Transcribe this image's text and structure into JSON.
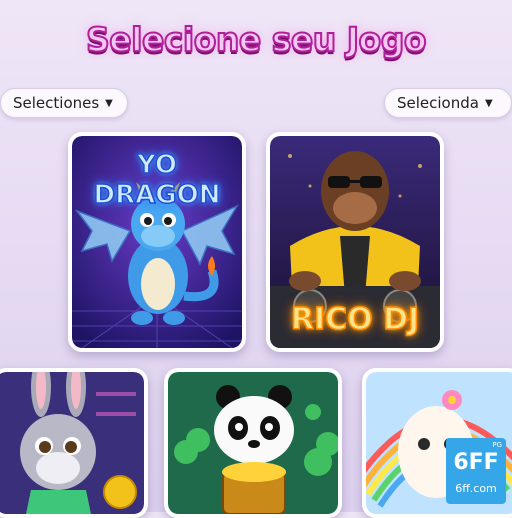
{
  "page": {
    "title": "Selecione seu Jogo"
  },
  "filters": {
    "left": {
      "value": "Selectiones",
      "icon": "caret-down-icon"
    },
    "right": {
      "value": "Selecionda",
      "icon": "caret-down-icon"
    }
  },
  "games": [
    {
      "id": "dragon",
      "title": "YO DRAGON"
    },
    {
      "id": "dj",
      "title": "RICO DJ"
    },
    {
      "id": "bunny",
      "title": ""
    },
    {
      "id": "panda",
      "title": ""
    },
    {
      "id": "llama",
      "title": ""
    }
  ],
  "watermark": {
    "logo": "6FF",
    "site": "6ff.com",
    "tag": "PG"
  },
  "colors": {
    "title_fill": "#f3c9f2",
    "title_stroke": "#b01f9b",
    "badge": "#35a7e8"
  }
}
